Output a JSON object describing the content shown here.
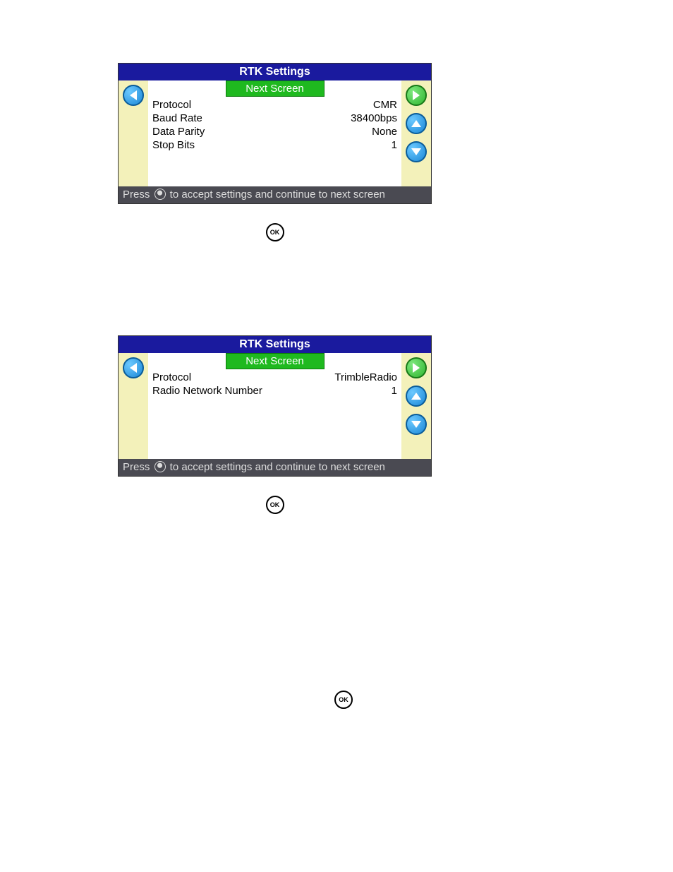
{
  "panel1": {
    "title": "RTK Settings",
    "next": "Next Screen",
    "rows": [
      {
        "label": "Protocol",
        "value": "CMR"
      },
      {
        "label": "Baud Rate",
        "value": "38400bps"
      },
      {
        "label": "Data Parity",
        "value": "None"
      },
      {
        "label": "Stop Bits",
        "value": "1"
      }
    ],
    "footer_pre": "Press ",
    "footer_post": " to accept settings and continue to next screen",
    "ok_glyph": "OK"
  },
  "panel2": {
    "title": "RTK Settings",
    "next": "Next Screen",
    "rows": [
      {
        "label": "Protocol",
        "value": "TrimbleRadio"
      },
      {
        "label": "Radio Network Number",
        "value": "1"
      }
    ],
    "footer_pre": "Press ",
    "footer_post": " to accept settings and continue to next screen",
    "ok_glyph": "OK"
  },
  "ok3": "OK"
}
